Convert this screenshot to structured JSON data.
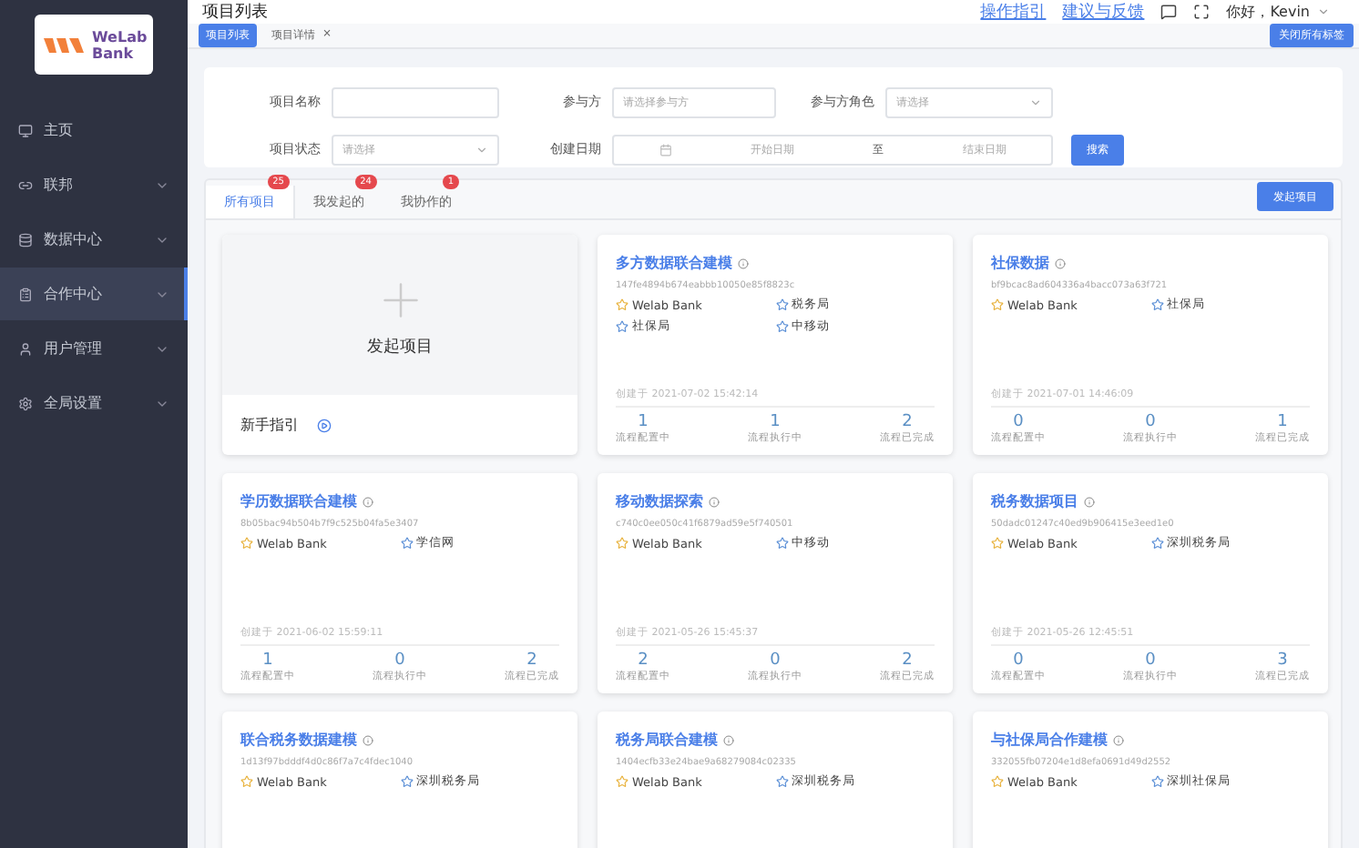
{
  "logo": {
    "text": "WeLab Bank"
  },
  "sidebar": {
    "items": [
      {
        "label": "主页",
        "kind": "link",
        "selected": false
      },
      {
        "label": "联邦",
        "kind": "group",
        "selected": false
      },
      {
        "label": "数据中心",
        "kind": "group",
        "selected": false
      },
      {
        "label": "合作中心",
        "kind": "group",
        "selected": true
      },
      {
        "label": "用户管理",
        "kind": "group",
        "selected": false
      },
      {
        "label": "全局设置",
        "kind": "group",
        "selected": false
      }
    ]
  },
  "header": {
    "title": "项目列表",
    "links": [
      "操作指引",
      "建议与反馈"
    ],
    "greeting": "你好，Kevin"
  },
  "page_tabs": {
    "tabs": [
      {
        "label": "项目列表",
        "selected": true
      },
      {
        "label": "项目详情",
        "selected": false,
        "close": "×"
      }
    ],
    "close_all": "关闭所有标签"
  },
  "filters": {
    "fields": [
      {
        "label": "项目名称",
        "kind": "input"
      },
      {
        "label": "参与方",
        "kind": "input",
        "placeholder": "请选择参与方"
      },
      {
        "label": "参与方角色",
        "kind": "select",
        "placeholder": "请选择"
      },
      {
        "label": "项目状态",
        "kind": "select",
        "placeholder": "请选择"
      },
      {
        "label": "创建日期",
        "kind": "daterange",
        "start": "开始日期",
        "separator": "至",
        "end": "结束日期"
      }
    ],
    "search": "搜索"
  },
  "project_tabs": {
    "tabs": [
      {
        "label": "所有项目",
        "count": "25",
        "selected": true
      },
      {
        "label": "我发起的",
        "count": "24",
        "selected": false
      },
      {
        "label": "我协作的",
        "count": "1",
        "selected": false
      }
    ],
    "new_button": "发起项目"
  },
  "new_card": {
    "title": "发起项目",
    "guide": "新手指引"
  },
  "projects": [
    {
      "title": "多方数据联合建模",
      "hash": "147fe4894b674eabbb10050e85f8823c",
      "parties": [
        {
          "name": "Welab Bank",
          "kind": "initiator"
        },
        {
          "name": "税务局",
          "kind": "partner"
        },
        {
          "name": "社保局",
          "kind": "partner"
        },
        {
          "name": "中移动",
          "kind": "partner"
        }
      ],
      "created": "创建于 2021-07-02 15:42:14",
      "stats": [
        {
          "value": "1",
          "label": "流程配置中"
        },
        {
          "value": "1",
          "label": "流程执行中"
        },
        {
          "value": "2",
          "label": "流程已完成"
        }
      ]
    },
    {
      "title": "社保数据",
      "hash": "bf9bcac8ad604336a4bacc073a63f721",
      "parties": [
        {
          "name": "Welab Bank",
          "kind": "initiator"
        },
        {
          "name": "社保局",
          "kind": "partner"
        }
      ],
      "created": "创建于 2021-07-01 14:46:09",
      "stats": [
        {
          "value": "0",
          "label": "流程配置中"
        },
        {
          "value": "0",
          "label": "流程执行中"
        },
        {
          "value": "1",
          "label": "流程已完成"
        }
      ]
    },
    {
      "title": "学历数据联合建模",
      "hash": "8b05bac94b504b7f9c525b04fa5e3407",
      "parties": [
        {
          "name": "Welab Bank",
          "kind": "initiator"
        },
        {
          "name": "学信网",
          "kind": "partner"
        }
      ],
      "created": "创建于 2021-06-02 15:59:11",
      "stats": [
        {
          "value": "1",
          "label": "流程配置中"
        },
        {
          "value": "0",
          "label": "流程执行中"
        },
        {
          "value": "2",
          "label": "流程已完成"
        }
      ]
    },
    {
      "title": "移动数据探索",
      "hash": "c740c0ee050c41f6879ad59e5f740501",
      "parties": [
        {
          "name": "Welab Bank",
          "kind": "initiator"
        },
        {
          "name": "中移动",
          "kind": "partner"
        }
      ],
      "created": "创建于 2021-05-26 15:45:37",
      "stats": [
        {
          "value": "2",
          "label": "流程配置中"
        },
        {
          "value": "0",
          "label": "流程执行中"
        },
        {
          "value": "2",
          "label": "流程已完成"
        }
      ]
    },
    {
      "title": "税务数据项目",
      "hash": "50dadc01247c40ed9b906415e3eed1e0",
      "parties": [
        {
          "name": "Welab Bank",
          "kind": "initiator"
        },
        {
          "name": "深圳税务局",
          "kind": "partner"
        }
      ],
      "created": "创建于 2021-05-26 12:45:51",
      "stats": [
        {
          "value": "0",
          "label": "流程配置中"
        },
        {
          "value": "0",
          "label": "流程执行中"
        },
        {
          "value": "3",
          "label": "流程已完成"
        }
      ]
    },
    {
      "title": "联合税务数据建模",
      "hash": "1d13f97bdddf4d0c86f7a7c4fdec1040",
      "parties": [
        {
          "name": "Welab Bank",
          "kind": "initiator"
        },
        {
          "name": "深圳税务局",
          "kind": "partner"
        }
      ]
    },
    {
      "title": "税务局联合建模",
      "hash": "1404ecfb33e24bae9a68279084c02335",
      "parties": [
        {
          "name": "Welab Bank",
          "kind": "initiator"
        },
        {
          "name": "深圳税务局",
          "kind": "partner"
        }
      ]
    },
    {
      "title": "与社保局合作建模",
      "hash": "332055fb07204e1d8efa0691d49d2552",
      "parties": [
        {
          "name": "Welab Bank",
          "kind": "initiator"
        },
        {
          "name": "深圳社保局",
          "kind": "partner"
        }
      ]
    }
  ]
}
